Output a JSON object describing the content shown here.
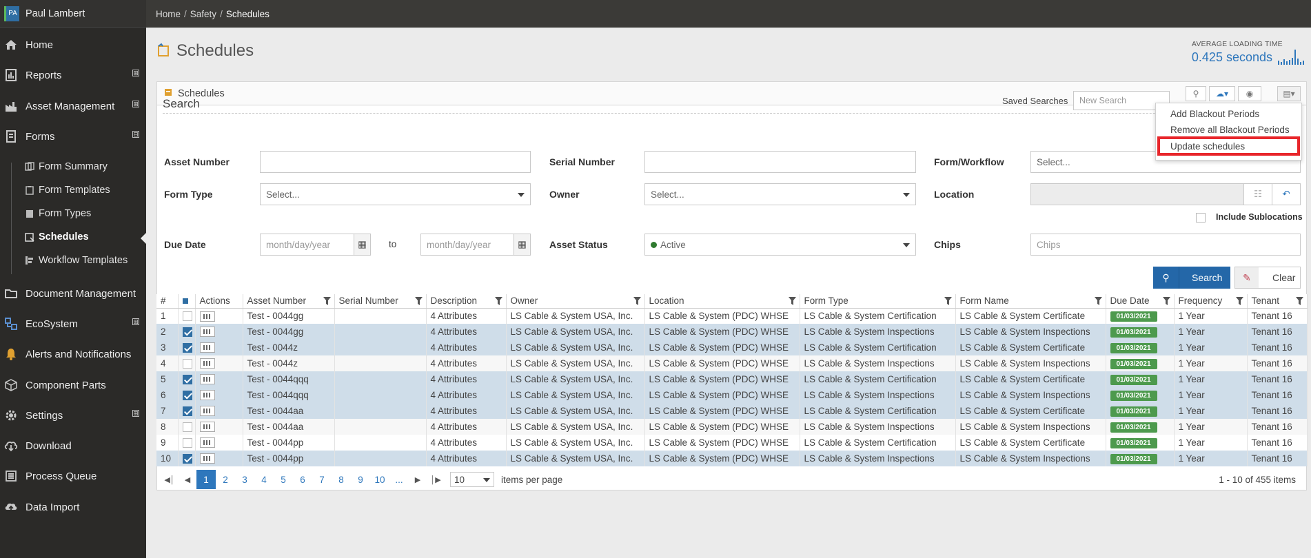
{
  "user": {
    "initials": "PA",
    "name": "Paul Lambert"
  },
  "breadcrumb": [
    "Home",
    "Safety",
    "Schedules"
  ],
  "sidebar": {
    "items": [
      {
        "label": "Home",
        "icon": "home-icon"
      },
      {
        "label": "Reports",
        "icon": "reports-icon",
        "expand": "⊞"
      },
      {
        "label": "Asset Management",
        "icon": "factory-icon",
        "expand": "⊞"
      },
      {
        "label": "Forms",
        "icon": "forms-icon",
        "expand": "⊟"
      },
      {
        "label": "Document Management",
        "icon": "folder-icon"
      },
      {
        "label": "EcoSystem",
        "icon": "ecosystem-icon",
        "expand": "⊞"
      },
      {
        "label": "Alerts and Notifications",
        "icon": "bell-icon"
      },
      {
        "label": "Component Parts",
        "icon": "cube-icon"
      },
      {
        "label": "Settings",
        "icon": "gear-icon",
        "expand": "⊞"
      },
      {
        "label": "Download",
        "icon": "download-icon"
      },
      {
        "label": "Process Queue",
        "icon": "queue-icon"
      },
      {
        "label": "Data Import",
        "icon": "cloud-upload-icon"
      }
    ],
    "forms_sub": [
      "Form Summary",
      "Form Templates",
      "Form Types",
      "Schedules",
      "Workflow Templates"
    ]
  },
  "page": {
    "title": "Schedules"
  },
  "loading": {
    "label": "AVERAGE LOADING TIME",
    "value": "0.425 seconds"
  },
  "panel": {
    "title": "Schedules"
  },
  "search": {
    "title": "Search",
    "saved_label": "Saved Searches",
    "saved_placeholder": "New Search",
    "asset_number_label": "Asset Number",
    "serial_number_label": "Serial Number",
    "form_workflow_label": "Form/Workflow",
    "form_workflow_value": "Select...",
    "form_type_label": "Form Type",
    "form_type_value": "Select...",
    "owner_label": "Owner",
    "owner_value": "Select...",
    "location_label": "Location",
    "include_sublocations_label": "Include Sublocations",
    "due_date_label": "Due Date",
    "date_from_placeholder": "month/day/year",
    "to_label": "to",
    "date_to_placeholder": "month/day/year",
    "asset_status_label": "Asset Status",
    "asset_status_value": "Active",
    "chips_label": "Chips",
    "chips_placeholder": "Chips",
    "search_button": "Search",
    "clear_button": "Clear"
  },
  "menu": {
    "items": [
      "Add Blackout Periods",
      "Remove all Blackout Periods",
      "Update schedules"
    ]
  },
  "grid": {
    "columns": [
      "#",
      "",
      "Actions",
      "Asset Number",
      "Serial Number",
      "Description",
      "Owner",
      "Location",
      "Form Type",
      "Form Name",
      "Due Date",
      "Frequency",
      "Tenant"
    ],
    "rows": [
      {
        "n": "1",
        "sel": false,
        "asset": "Test - 0044gg",
        "serial": "",
        "desc": "4 Attributes",
        "owner": "LS Cable & System USA, Inc.",
        "loc": "LS Cable & System (PDC) WHSE",
        "ftype": "LS Cable & System Certification",
        "fname": "LS Cable & System Certificate",
        "due": "01/03/2021",
        "freq": "1 Year",
        "tenant": "Tenant 16"
      },
      {
        "n": "2",
        "sel": true,
        "asset": "Test - 0044gg",
        "serial": "",
        "desc": "4 Attributes",
        "owner": "LS Cable & System USA, Inc.",
        "loc": "LS Cable & System (PDC) WHSE",
        "ftype": "LS Cable & System Inspections",
        "fname": "LS Cable & System Inspections",
        "due": "01/03/2021",
        "freq": "1 Year",
        "tenant": "Tenant 16"
      },
      {
        "n": "3",
        "sel": true,
        "asset": "Test - 0044z",
        "serial": "",
        "desc": "4 Attributes",
        "owner": "LS Cable & System USA, Inc.",
        "loc": "LS Cable & System (PDC) WHSE",
        "ftype": "LS Cable & System Certification",
        "fname": "LS Cable & System Certificate",
        "due": "01/03/2021",
        "freq": "1 Year",
        "tenant": "Tenant 16"
      },
      {
        "n": "4",
        "sel": false,
        "asset": "Test - 0044z",
        "serial": "",
        "desc": "4 Attributes",
        "owner": "LS Cable & System USA, Inc.",
        "loc": "LS Cable & System (PDC) WHSE",
        "ftype": "LS Cable & System Inspections",
        "fname": "LS Cable & System Inspections",
        "due": "01/03/2021",
        "freq": "1 Year",
        "tenant": "Tenant 16"
      },
      {
        "n": "5",
        "sel": true,
        "asset": "Test - 0044qqq",
        "serial": "",
        "desc": "4 Attributes",
        "owner": "LS Cable & System USA, Inc.",
        "loc": "LS Cable & System (PDC) WHSE",
        "ftype": "LS Cable & System Certification",
        "fname": "LS Cable & System Certificate",
        "due": "01/03/2021",
        "freq": "1 Year",
        "tenant": "Tenant 16"
      },
      {
        "n": "6",
        "sel": true,
        "asset": "Test - 0044qqq",
        "serial": "",
        "desc": "4 Attributes",
        "owner": "LS Cable & System USA, Inc.",
        "loc": "LS Cable & System (PDC) WHSE",
        "ftype": "LS Cable & System Inspections",
        "fname": "LS Cable & System Inspections",
        "due": "01/03/2021",
        "freq": "1 Year",
        "tenant": "Tenant 16"
      },
      {
        "n": "7",
        "sel": true,
        "asset": "Test - 0044aa",
        "serial": "",
        "desc": "4 Attributes",
        "owner": "LS Cable & System USA, Inc.",
        "loc": "LS Cable & System (PDC) WHSE",
        "ftype": "LS Cable & System Certification",
        "fname": "LS Cable & System Certificate",
        "due": "01/03/2021",
        "freq": "1 Year",
        "tenant": "Tenant 16"
      },
      {
        "n": "8",
        "sel": false,
        "asset": "Test - 0044aa",
        "serial": "",
        "desc": "4 Attributes",
        "owner": "LS Cable & System USA, Inc.",
        "loc": "LS Cable & System (PDC) WHSE",
        "ftype": "LS Cable & System Inspections",
        "fname": "LS Cable & System Inspections",
        "due": "01/03/2021",
        "freq": "1 Year",
        "tenant": "Tenant 16"
      },
      {
        "n": "9",
        "sel": false,
        "asset": "Test - 0044pp",
        "serial": "",
        "desc": "4 Attributes",
        "owner": "LS Cable & System USA, Inc.",
        "loc": "LS Cable & System (PDC) WHSE",
        "ftype": "LS Cable & System Certification",
        "fname": "LS Cable & System Certificate",
        "due": "01/03/2021",
        "freq": "1 Year",
        "tenant": "Tenant 16"
      },
      {
        "n": "10",
        "sel": true,
        "asset": "Test - 0044pp",
        "serial": "",
        "desc": "4 Attributes",
        "owner": "LS Cable & System USA, Inc.",
        "loc": "LS Cable & System (PDC) WHSE",
        "ftype": "LS Cable & System Inspections",
        "fname": "LS Cable & System Inspections",
        "due": "01/03/2021",
        "freq": "1 Year",
        "tenant": "Tenant 16"
      }
    ]
  },
  "pager": {
    "pages": [
      "1",
      "2",
      "3",
      "4",
      "5",
      "6",
      "7",
      "8",
      "9",
      "10",
      "..."
    ],
    "current": "1",
    "page_size": "10",
    "per_page_label": "items per page",
    "summary": "1 - 10 of 455 items"
  },
  "colors": {
    "accent": "#2e77bc",
    "sidebar": "#2b2a28",
    "selected_row": "#cfdde9",
    "due_badge": "#4d9a4d",
    "highlight": "#e8262b"
  }
}
